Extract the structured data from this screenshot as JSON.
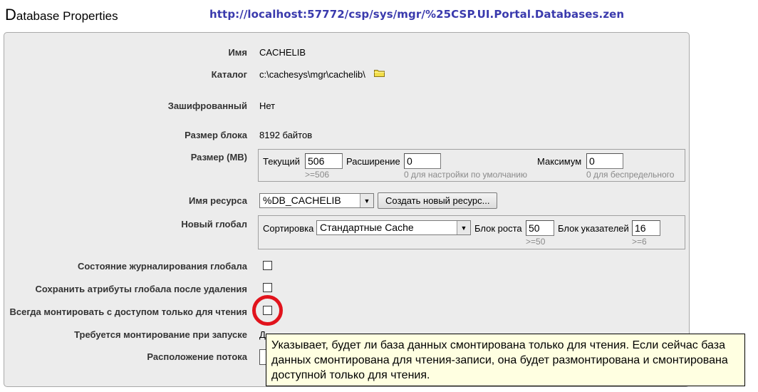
{
  "header": {
    "title_initial": "D",
    "title_rest": "atabase Properties",
    "url": "http://localhost:57772/csp/sys/mgr/%25CSP.UI.Portal.Databases.zen"
  },
  "form": {
    "name": {
      "label": "Имя",
      "value": "CACHELIB"
    },
    "directory": {
      "label": "Каталог",
      "value": "c:\\cachesys\\mgr\\cachelib\\",
      "icon": "folder-icon"
    },
    "encrypted": {
      "label": "Зашифрованный",
      "value": "Нет"
    },
    "block_size": {
      "label": "Размер блока",
      "value": "8192 байтов"
    },
    "size": {
      "label": "Размер (MB)",
      "current_label": "Текущий",
      "current_value": "506",
      "current_hint": ">=506",
      "expansion_label": "Расширение",
      "expansion_value": "0",
      "expansion_hint": "0 для настройки по умолчанию",
      "max_label": "Максимум",
      "max_value": "0",
      "max_hint": "0 для беспредельного"
    },
    "resource": {
      "label": "Имя ресурса",
      "selected": "%DB_CACHELIB",
      "create_button": "Создать новый ресурс..."
    },
    "new_global": {
      "label": "Новый глобал",
      "collation_label": "Сортировка",
      "collation_selected": "Стандартные Cache",
      "growth_label": "Блок роста",
      "growth_value": "50",
      "growth_hint": ">=50",
      "pointer_label": "Блок указателей",
      "pointer_value": "16",
      "pointer_hint": ">=6"
    },
    "journal_state": {
      "label": "Состояние журналирования глобала",
      "checked": false
    },
    "preserve_attrs": {
      "label": "Сохранить атрибуты глобала после удаления",
      "checked": false
    },
    "mount_readonly": {
      "label": "Всегда монтировать с доступом только для чтения",
      "checked": false
    },
    "mount_required": {
      "label": "Требуется монтирование при запуске",
      "value_partial": "Д"
    },
    "stream_location": {
      "label": "Расположение потока"
    }
  },
  "tooltip": {
    "text": "Указывает, будет ли база данных смонтирована только для чтения. Если сейчас база данных смонтирована для чтения-записи, она будет размонтирована и смонтирована доступной только для чтения."
  },
  "colors": {
    "url": "#3a3aad",
    "highlight": "#e1131c",
    "tooltip_bg": "#ffffe1",
    "panel_bg": "#ececec"
  }
}
